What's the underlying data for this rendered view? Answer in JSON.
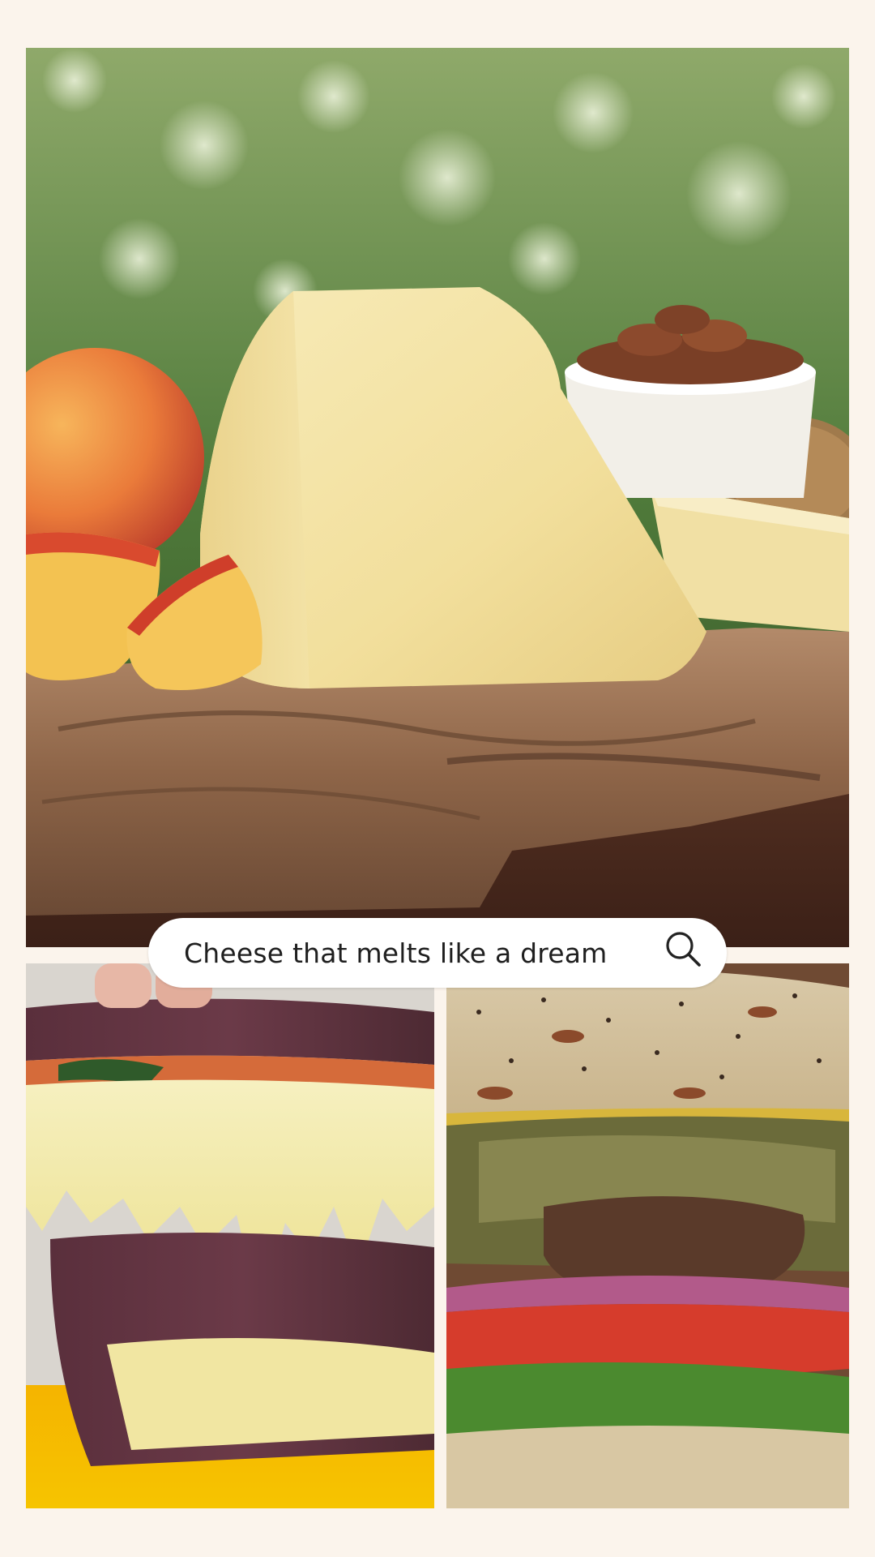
{
  "search": {
    "text": "Cheese that melts like a dream",
    "icon": "search-icon"
  },
  "images": {
    "top": "cheese-board-photo",
    "bottom_left": "grilled-cheese-photo",
    "bottom_right": "burger-photo"
  },
  "colors": {
    "background": "#fbf4ec",
    "pill": "#ffffff",
    "text": "#1f1f1f"
  }
}
